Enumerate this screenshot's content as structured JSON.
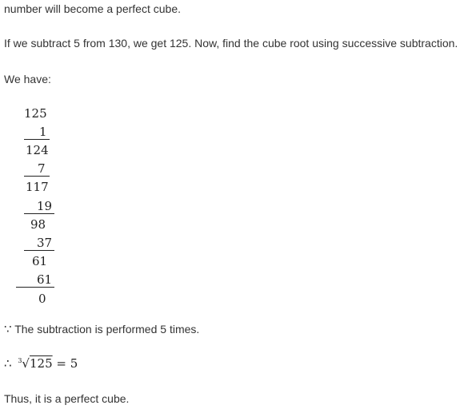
{
  "intro_line": "number will become a perfect cube.",
  "subtract_sentence": "If we subtract 5 from 130, we get 125. Now, find the cube root using successive subtraction.",
  "we_have": "We have:",
  "subtraction": {
    "start": "125",
    "steps": [
      {
        "subtract": "1",
        "result": "124"
      },
      {
        "subtract": "7",
        "result": "117"
      },
      {
        "subtract": "19",
        "result": "98"
      },
      {
        "subtract": "37",
        "result": "61"
      },
      {
        "subtract": "61",
        "result": "0"
      }
    ]
  },
  "because_symbol": "∵",
  "because_text": "The subtraction is performed 5 times.",
  "therefore_symbol": "∴",
  "root_index": "3",
  "root_radicand": "125",
  "root_equals": "= 5",
  "conclusion": "Thus, it is a perfect cube."
}
